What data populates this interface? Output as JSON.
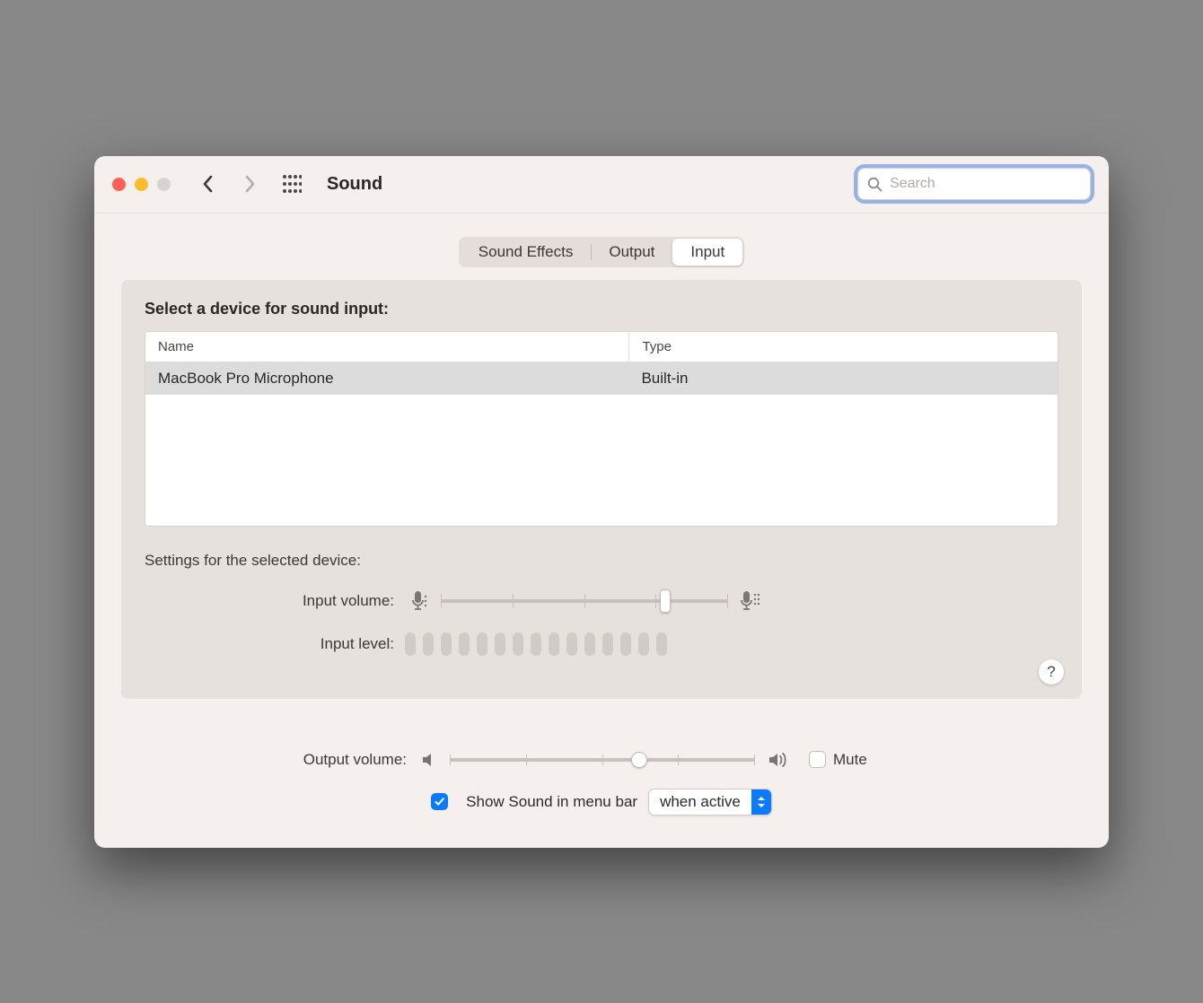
{
  "header": {
    "title": "Sound",
    "search_placeholder": "Search"
  },
  "tabs": {
    "items": [
      {
        "label": "Sound Effects"
      },
      {
        "label": "Output"
      },
      {
        "label": "Input"
      }
    ],
    "active_index": 2
  },
  "panel": {
    "list_heading": "Select a device for sound input:",
    "columns": {
      "name": "Name",
      "type": "Type"
    },
    "devices": [
      {
        "name": "MacBook Pro Microphone",
        "type": "Built-in"
      }
    ],
    "settings_heading": "Settings for the selected device:",
    "input_volume_label": "Input volume:",
    "input_volume_percent": 78,
    "input_level_label": "Input level:",
    "input_level_bar_count": 15,
    "help_label": "?"
  },
  "footer": {
    "output_volume_label": "Output volume:",
    "output_volume_percent": 62,
    "mute_label": "Mute",
    "mute_checked": false,
    "show_in_menubar_label": "Show Sound in menu bar",
    "show_in_menubar_checked": true,
    "menubar_mode_selected": "when active"
  }
}
